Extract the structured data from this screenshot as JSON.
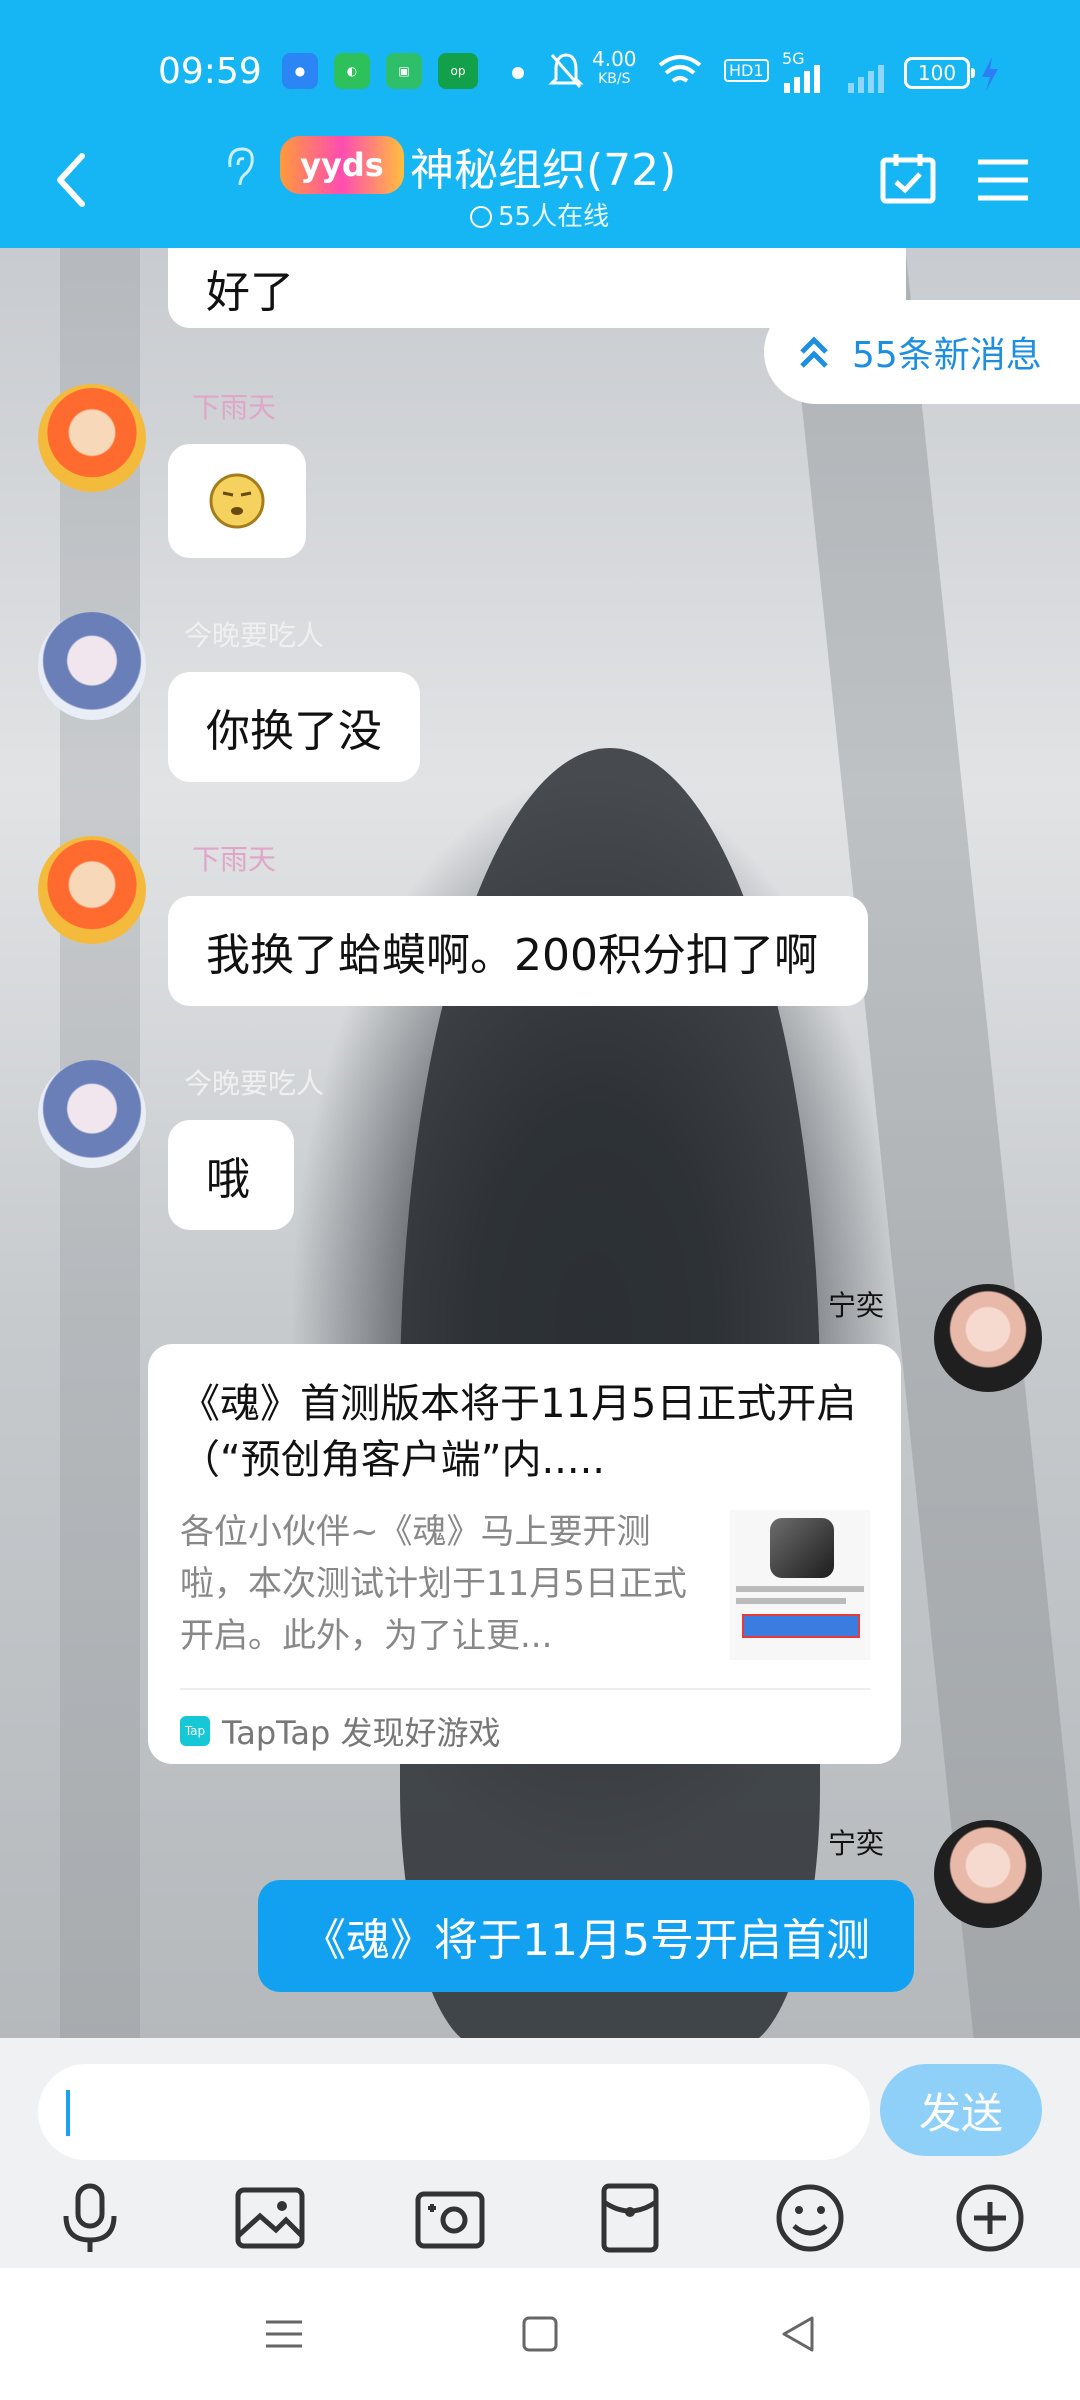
{
  "status_bar": {
    "time": "09:59",
    "speed_value": "4.00",
    "speed_unit": "KB/S",
    "hd": "HD1",
    "network": "5G",
    "battery": "100"
  },
  "header": {
    "badge": "yyds",
    "title": "神秘组织(72)",
    "online": "55人在线"
  },
  "new_messages": "55条新消息",
  "messages": [
    {
      "sender": "",
      "text": "好了"
    },
    {
      "sender": "下雨天",
      "text": ""
    },
    {
      "sender": "今晚要吃人",
      "text": "你换了没"
    },
    {
      "sender": "下雨天",
      "text": "我换了蛤蟆啊。200积分扣了啊"
    },
    {
      "sender": "今晚要吃人",
      "text": "哦"
    },
    {
      "sender": "宁奕",
      "card": {
        "title": "《魂》首测版本将于11月5日正式开启（“预创角客户端”内.....",
        "desc": "各位小伙伴~《魂》马上要开测啦，本次测试计划于11月5日正式开启。此外，为了让更...",
        "source": "TapTap 发现好游戏",
        "tap_logo": "Tap"
      }
    },
    {
      "sender": "宁奕",
      "text": "《魂》将于11月5号开启首测"
    }
  ],
  "input": {
    "value": "",
    "send_label": "发送"
  },
  "toolbar_icons": [
    "mic-icon",
    "image-icon",
    "camera-icon",
    "red-packet-icon",
    "emoji-icon",
    "plus-icon"
  ],
  "nav_icons": [
    "menu-nav-icon",
    "home-nav-icon",
    "back-nav-icon"
  ],
  "colors": {
    "header_bg": "#16b6f5",
    "accent": "#12a0f0",
    "send_btn": "#8fd0f9"
  }
}
